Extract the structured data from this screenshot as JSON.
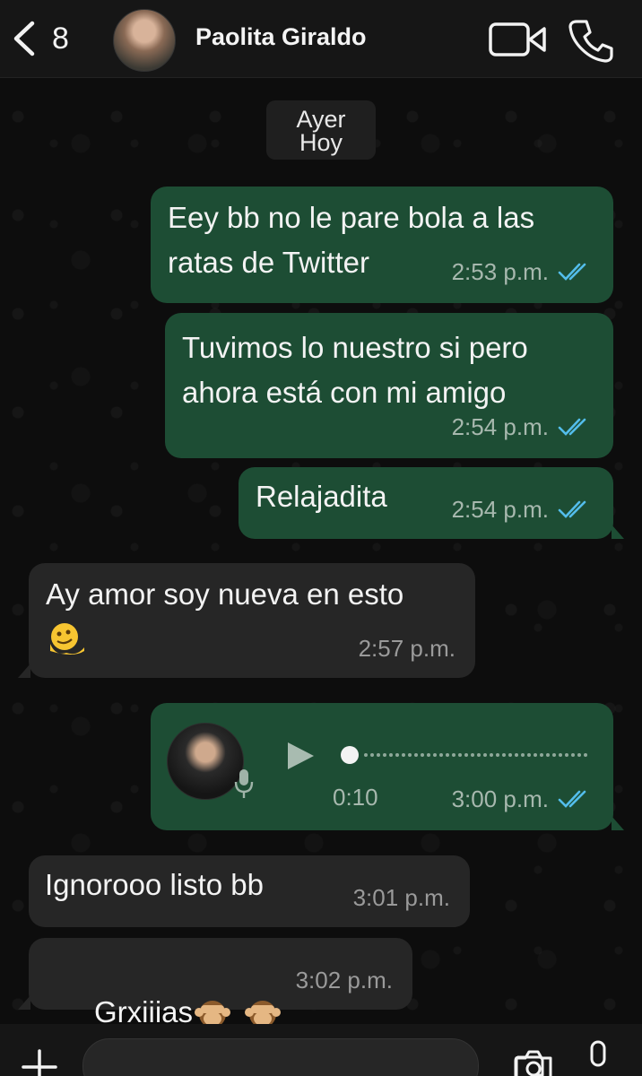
{
  "header": {
    "back_count": "8",
    "contact_name": "Paolita Giraldo"
  },
  "date_chip": {
    "line1": "Ayer",
    "line2": "Hoy"
  },
  "messages": [
    {
      "direction": "out",
      "text": "Eey bb no le pare bola a las\nratas de Twitter",
      "time": "2:53 p.m.",
      "read": true
    },
    {
      "direction": "out",
      "text": "Tuvimos lo nuestro si pero\nahora está con mi amigo",
      "time": "2:54 p.m.",
      "read": true
    },
    {
      "direction": "out",
      "text": "Relajadita",
      "time": "2:54 p.m.",
      "read": true
    },
    {
      "direction": "in",
      "text": "Ay amor soy nueva en esto",
      "emoji": "melting-face",
      "time": "2:57 p.m."
    },
    {
      "direction": "out",
      "type": "voice",
      "duration": "0:10",
      "progress": 0,
      "time": "3:00 p.m.",
      "read": true
    },
    {
      "direction": "in",
      "text": "Ignorooo listo bb",
      "time": "3:01 p.m."
    },
    {
      "direction": "in",
      "text": "Grxiiias",
      "emoji": "see-no-evil-monkey x2",
      "time": "3:02 p.m."
    }
  ],
  "icons": {
    "back": "chevron-left-icon",
    "video": "video-call-icon",
    "call": "phone-icon",
    "play": "play-icon",
    "mic": "microphone-icon",
    "ticks": "double-check-icon",
    "plus": "plus-icon",
    "sticker": "sticker-icon",
    "camera": "camera-icon"
  },
  "colors": {
    "outgoing_bubble": "#1d4d34",
    "incoming_bubble": "#262626",
    "read_ticks": "#53bdeb",
    "background": "#0d0d0d"
  }
}
